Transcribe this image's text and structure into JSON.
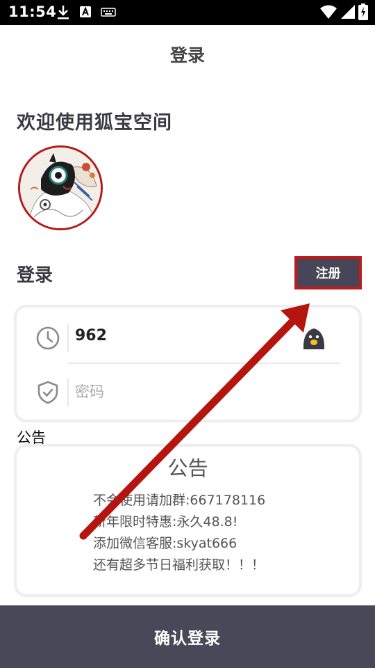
{
  "status_bar": {
    "time": "11:54",
    "icons": [
      "download-icon",
      "a-text-icon",
      "keyboard-icon",
      "wifi-icon",
      "signal-icon",
      "battery-icon"
    ]
  },
  "header": {
    "title": "登录"
  },
  "welcome": {
    "text": "欢迎使用狐宝空间"
  },
  "login": {
    "label": "登录",
    "register_label": "注册",
    "username_value": "962",
    "password_placeholder": "密码",
    "icons": [
      "clock-icon",
      "shield-check-icon",
      "mascot-icon"
    ]
  },
  "notice": {
    "section_label": "公告",
    "title": "公告",
    "lines": [
      "不会使用请加群:667178116",
      "新年限时特惠:永久48.8!",
      "添加微信客服:skyat666",
      "还有超多节日福利获取！！！"
    ]
  },
  "confirm": {
    "label": "确认登录"
  },
  "colors": {
    "button_dark": "#474659",
    "highlight_red": "#c01a1a",
    "arrow_red": "#b5140f"
  }
}
